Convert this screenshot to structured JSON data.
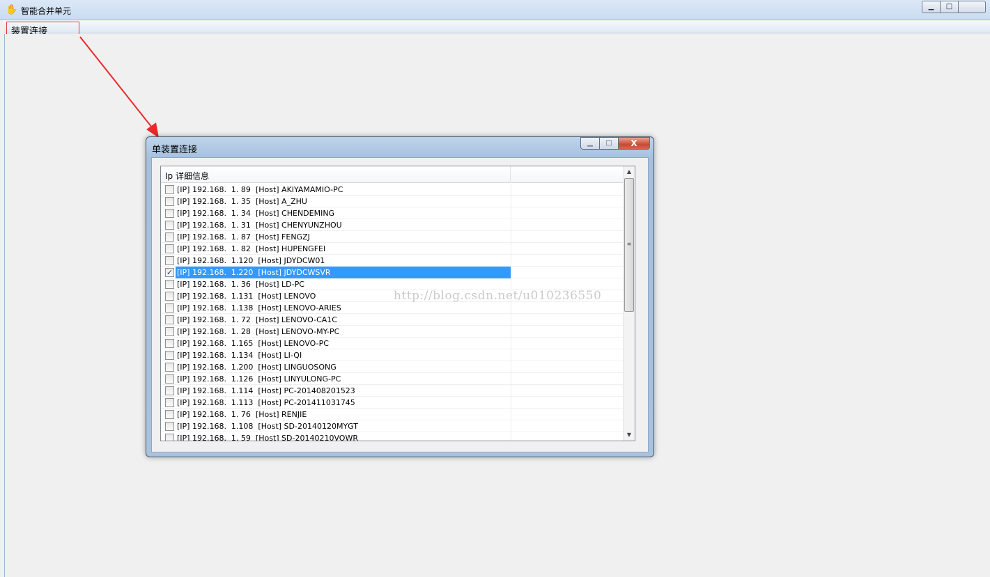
{
  "main_window": {
    "title": "智能合并单元",
    "icon": "hand-icon",
    "controls": {
      "minimize": "▁",
      "maximize": "□",
      "close": ""
    }
  },
  "menu": {
    "items": [
      {
        "label": "装置连接"
      }
    ]
  },
  "annotation": {
    "color": "#e82a2a"
  },
  "dialog": {
    "title": "单装置连接",
    "controls": {
      "minimize": "▁",
      "maximize": "□",
      "close": "X"
    },
    "list": {
      "columns": [
        "Ip 详细信息",
        ""
      ],
      "rows": [
        {
          "text": "[IP] 192.168.  1. 89  [Host] AKIYAMAMIO-PC",
          "checked": false
        },
        {
          "text": "[IP] 192.168.  1. 35  [Host] A_ZHU",
          "checked": false
        },
        {
          "text": "[IP] 192.168.  1. 34  [Host] CHENDEMING",
          "checked": false
        },
        {
          "text": "[IP] 192.168.  1. 31  [Host] CHENYUNZHOU",
          "checked": false
        },
        {
          "text": "[IP] 192.168.  1. 87  [Host] FENGZJ",
          "checked": false
        },
        {
          "text": "[IP] 192.168.  1. 82  [Host] HUPENGFEI",
          "checked": false
        },
        {
          "text": "[IP] 192.168.  1.120  [Host] JDYDCW01",
          "checked": false
        },
        {
          "text": "[IP] 192.168.  1.220  [Host] JDYDCWSVR",
          "checked": true,
          "selected": true
        },
        {
          "text": "[IP] 192.168.  1. 36  [Host] LD-PC",
          "checked": false
        },
        {
          "text": "[IP] 192.168.  1.131  [Host] LENOVO",
          "checked": false
        },
        {
          "text": "[IP] 192.168.  1.138  [Host] LENOVO-ARIES",
          "checked": false
        },
        {
          "text": "[IP] 192.168.  1. 72  [Host] LENOVO-CA1C",
          "checked": false
        },
        {
          "text": "[IP] 192.168.  1. 28  [Host] LENOVO-MY-PC",
          "checked": false
        },
        {
          "text": "[IP] 192.168.  1.165  [Host] LENOVO-PC",
          "checked": false
        },
        {
          "text": "[IP] 192.168.  1.134  [Host] LI-QI",
          "checked": false
        },
        {
          "text": "[IP] 192.168.  1.200  [Host] LINGUOSONG",
          "checked": false
        },
        {
          "text": "[IP] 192.168.  1.126  [Host] LINYULONG-PC",
          "checked": false
        },
        {
          "text": "[IP] 192.168.  1.114  [Host] PC-201408201523",
          "checked": false
        },
        {
          "text": "[IP] 192.168.  1.113  [Host] PC-201411031745",
          "checked": false
        },
        {
          "text": "[IP] 192.168.  1. 76  [Host] RENJIE",
          "checked": false
        },
        {
          "text": "[IP] 192.168.  1.108  [Host] SD-20140120MYGT",
          "checked": false
        },
        {
          "text": "[IP] 192.168.  1. 59  [Host] SD-20140210VOWR",
          "checked": false
        }
      ],
      "scroll": {
        "up": "▲",
        "down": "▼",
        "grip": "≡",
        "position": 0
      }
    },
    "selection_color": "#3399ff"
  },
  "watermark": "http://blog.csdn.net/u010236550"
}
